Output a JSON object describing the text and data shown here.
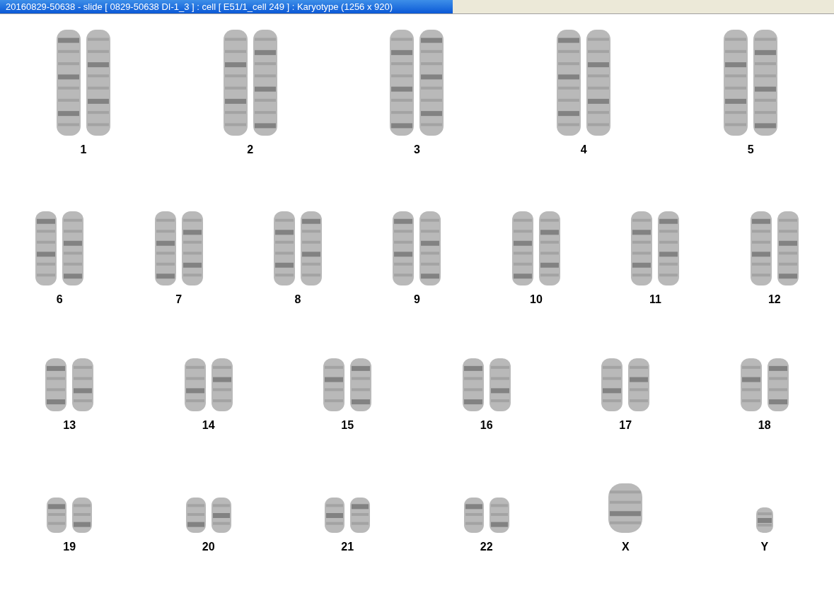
{
  "window": {
    "title": "20160829-50638 - slide [ 0829-50638 DI-1_3 ] : cell [ E51/1_cell 249 ] : Karyotype  (1256 x 920)"
  },
  "rows": [
    {
      "items": [
        {
          "label": "1",
          "kind": "pair"
        },
        {
          "label": "2",
          "kind": "pair"
        },
        {
          "label": "3",
          "kind": "pair"
        },
        {
          "label": "4",
          "kind": "pair"
        },
        {
          "label": "5",
          "kind": "pair"
        }
      ]
    },
    {
      "items": [
        {
          "label": "6",
          "kind": "pair"
        },
        {
          "label": "7",
          "kind": "pair"
        },
        {
          "label": "8",
          "kind": "pair"
        },
        {
          "label": "9",
          "kind": "pair"
        },
        {
          "label": "10",
          "kind": "pair"
        },
        {
          "label": "11",
          "kind": "pair"
        },
        {
          "label": "12",
          "kind": "pair"
        }
      ]
    },
    {
      "items": [
        {
          "label": "13",
          "kind": "pair"
        },
        {
          "label": "14",
          "kind": "pair"
        },
        {
          "label": "15",
          "kind": "pair"
        },
        {
          "label": "16",
          "kind": "pair"
        },
        {
          "label": "17",
          "kind": "pair"
        },
        {
          "label": "18",
          "kind": "pair"
        }
      ]
    },
    {
      "items": [
        {
          "label": "19",
          "kind": "pair"
        },
        {
          "label": "20",
          "kind": "pair"
        },
        {
          "label": "21",
          "kind": "pair"
        },
        {
          "label": "22",
          "kind": "pair"
        },
        {
          "label": "X",
          "kind": "single"
        },
        {
          "label": "Y",
          "kind": "single"
        }
      ]
    }
  ]
}
